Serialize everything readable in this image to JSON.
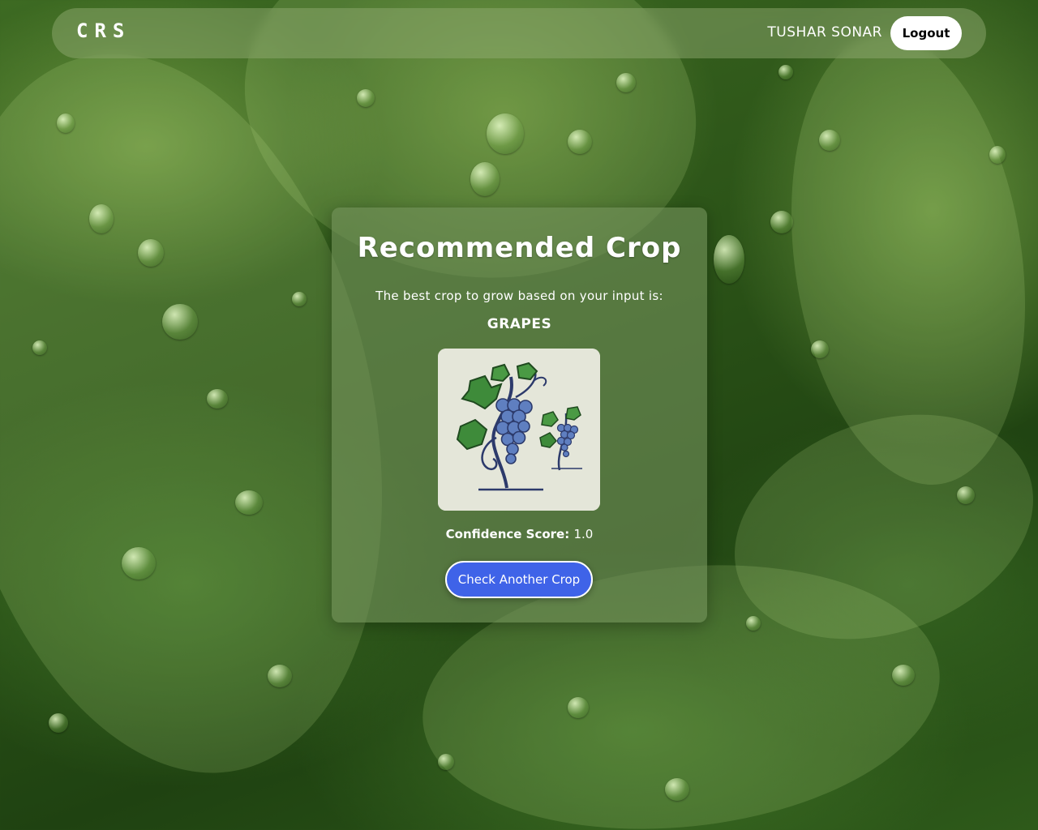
{
  "navbar": {
    "brand": "CRS",
    "user_name": "TUSHAR SONAR",
    "logout_label": "Logout"
  },
  "result": {
    "title": "Recommended Crop",
    "subtitle": "The best crop to grow based on your input is:",
    "crop_name": "GRAPES",
    "image_icon": "grapes-illustration",
    "confidence_label": "Confidence Score:",
    "confidence_value": "1.0",
    "retry_label": "Check Another Crop"
  },
  "colors": {
    "button_primary": "#3f63e8",
    "card_bg": "#73915a",
    "grape": "#5f7fc0",
    "leaf": "#3e8b3a"
  }
}
